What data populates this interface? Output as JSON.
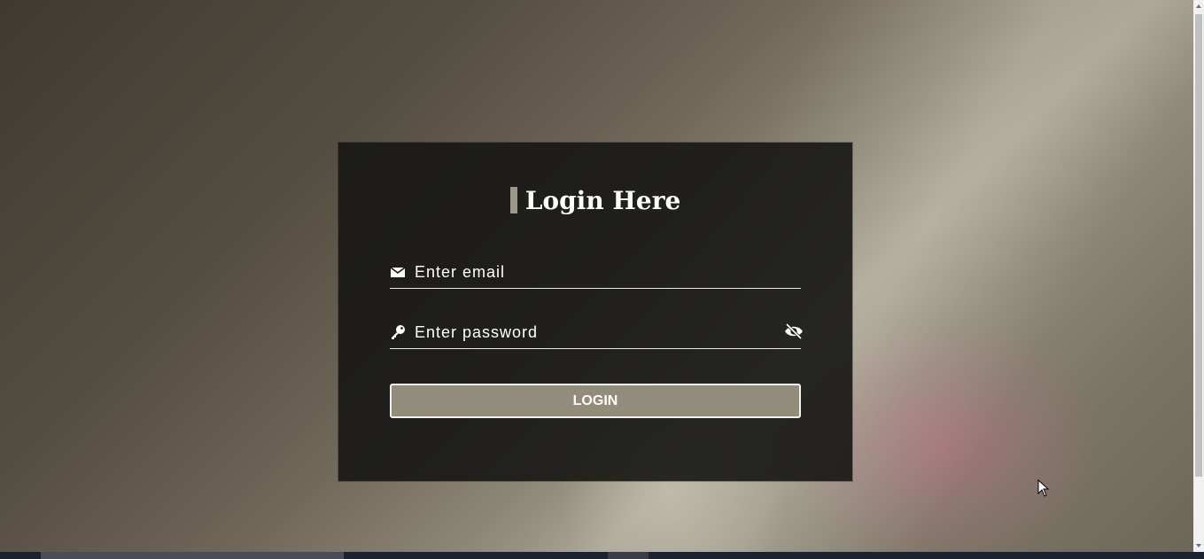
{
  "login": {
    "title": "Login Here",
    "email_placeholder": "Enter email",
    "password_placeholder": "Enter password",
    "button_label": "LOGIN"
  },
  "icons": {
    "email": "envelope-icon",
    "password": "key-icon",
    "toggle": "eye-slash-icon"
  },
  "colors": {
    "card_background": "#161614",
    "accent": "#928c7b",
    "text": "#ffffff"
  }
}
